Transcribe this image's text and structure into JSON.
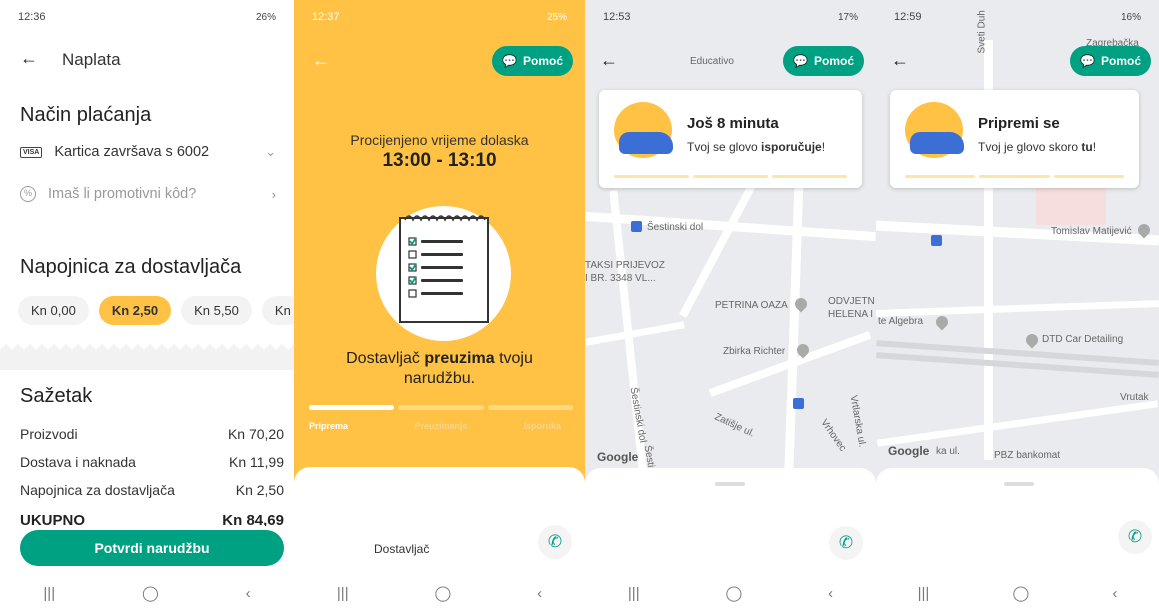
{
  "panel1": {
    "status_time": "12:36",
    "status_right": "26%",
    "title": "Naplata",
    "payment_heading": "Način plaćanja",
    "card_label": "Kartica završava s 6002",
    "card_brand": "VISA",
    "promo_label": "Imaš li promotivni kôd?",
    "tip_heading": "Napojnica za dostavljača",
    "tips": [
      "Kn 0,00",
      "Kn 2,50",
      "Kn 5,50",
      "Kn"
    ],
    "selected_tip": "Kn 2,50",
    "summary_heading": "Sažetak",
    "summary": [
      {
        "label": "Proizvodi",
        "value": "Kn 70,20"
      },
      {
        "label": "Dostava i naknada",
        "value": "Kn 11,99"
      },
      {
        "label": "Napojnica za dostavljača",
        "value": "Kn 2,50"
      }
    ],
    "total_label": "UKUPNO",
    "total_value": "Kn 84,69",
    "confirm_button": "Potvrdi narudžbu"
  },
  "panel2": {
    "status_time": "12:37",
    "status_right": "25%",
    "help_label": "Pomoć",
    "eta_label": "Procijenjeno vrijeme dolaska",
    "eta": "13:00 - 13:10",
    "message_pre": "Dostavljač ",
    "message_bold": "preuzima",
    "message_post": " tvoju narudžbu.",
    "steps": [
      "Priprema",
      "Preuzimanje",
      "Isporuka"
    ],
    "courier_label": "Dostavljač"
  },
  "panel3": {
    "status_time": "12:53",
    "status_right": "17%",
    "help_label": "Pomoć",
    "card_title": "Još 8 minuta",
    "card_pre": "Tvoj se glovo ",
    "card_bold": "isporučuje",
    "card_post": "!",
    "map_labels": [
      "Educativo",
      "Šestinski dol",
      "TAKSI PRIJEVOZ",
      "I BR. 3348 VL...",
      "PETRINA OAZA",
      "ODVJETN",
      "HELENA I",
      "Zbirka Richter",
      "Šestinski dol",
      "Vrhovec",
      "Zatišje ul.",
      "Vrhovec",
      "Vrtlarska ul.",
      "Šestin"
    ],
    "google": "Google"
  },
  "panel4": {
    "status_time": "12:59",
    "status_right": "16%",
    "help_label": "Pomoć",
    "card_title": "Pripremi se",
    "card_pre": "Tvoj je glovo skoro ",
    "card_bold": "tu",
    "card_post": "!",
    "map_labels": [
      "Zagrebačka",
      "Sveti Duh",
      "Tomislav Matijević",
      "te Algebra",
      "DTD Car Detailing",
      "Vrutak",
      "PBZ bankomat",
      "ka ul."
    ],
    "google": "Google"
  },
  "colors": {
    "brand_green": "#00a082",
    "brand_yellow": "#ffc244"
  }
}
